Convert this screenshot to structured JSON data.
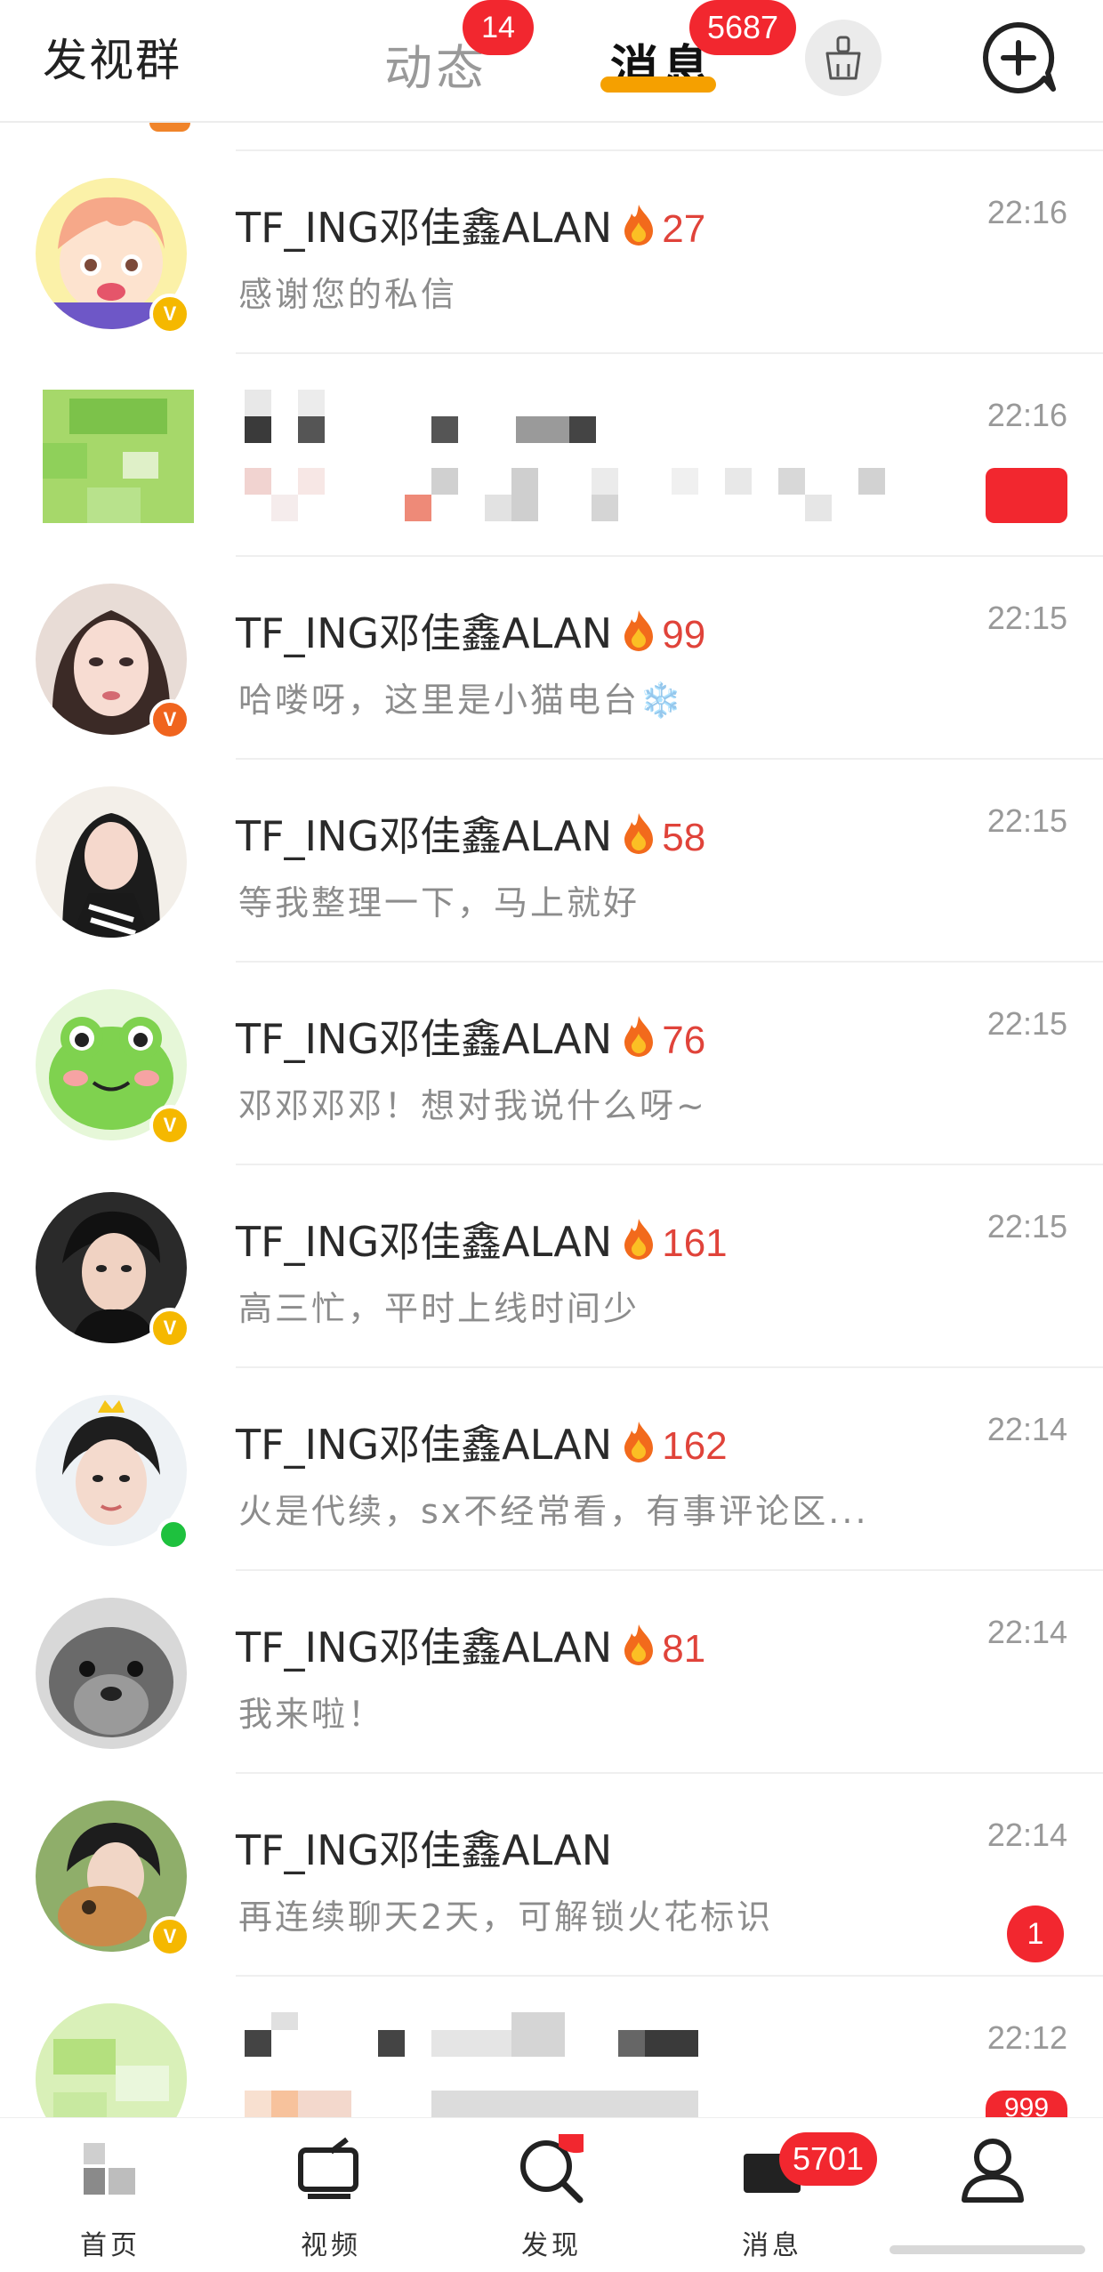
{
  "topbar": {
    "discover": "发视群",
    "tabs": [
      {
        "label": "动态",
        "badge": "14"
      },
      {
        "label": "消息",
        "badge": "5687"
      }
    ],
    "clean_icon": "broom-icon",
    "new_chat_icon": "add-chat-icon"
  },
  "conversations": [
    {
      "name": "TF_ING邓佳鑫ALAN",
      "streak": "27",
      "preview": "感谢您的私信",
      "time": "22:16",
      "badge_type": "gold"
    },
    {
      "name": "",
      "streak": "",
      "preview": "",
      "time": "22:16",
      "blurred": true
    },
    {
      "name": "TF_ING邓佳鑫ALAN",
      "streak": "99",
      "preview": "哈喽呀，这里是小猫电台❄️",
      "time": "22:15",
      "badge_type": "orange"
    },
    {
      "name": "TF_ING邓佳鑫ALAN",
      "streak": "58",
      "preview": "等我整理一下，马上就好",
      "time": "22:15"
    },
    {
      "name": "TF_ING邓佳鑫ALAN",
      "streak": "76",
      "preview": "邓邓邓邓！想对我说什么呀~",
      "time": "22:15",
      "badge_type": "gold"
    },
    {
      "name": "TF_ING邓佳鑫ALAN",
      "streak": "161",
      "preview": "高三忙，平时上线时间少",
      "time": "22:15",
      "badge_type": "gold"
    },
    {
      "name": "TF_ING邓佳鑫ALAN",
      "streak": "162",
      "preview": "火是代续，sx不经常看，有事评论区...",
      "time": "22:14",
      "online": true
    },
    {
      "name": "TF_ING邓佳鑫ALAN",
      "streak": "81",
      "preview": "我来啦！",
      "time": "22:14"
    },
    {
      "name": "TF_ING邓佳鑫ALAN",
      "streak": "",
      "preview": "再连续聊天2天，可解锁火花标识",
      "time": "22:14",
      "unread": "1",
      "badge_type": "gold"
    },
    {
      "name": "",
      "streak": "",
      "preview": "",
      "time": "22:12",
      "blurred": true,
      "unread": "999"
    }
  ],
  "bottomnav": {
    "items": [
      {
        "label": "首页",
        "icon": "home-icon"
      },
      {
        "label": "视频",
        "icon": "video-icon"
      },
      {
        "label": "发现",
        "icon": "discover-icon"
      },
      {
        "label": "消息",
        "icon": "message-icon",
        "badge": "5701"
      },
      {
        "label": "",
        "icon": "profile-icon"
      }
    ]
  },
  "colors": {
    "accent": "#f5a000",
    "badge": "#f2272f",
    "streak": "#e0433a"
  }
}
